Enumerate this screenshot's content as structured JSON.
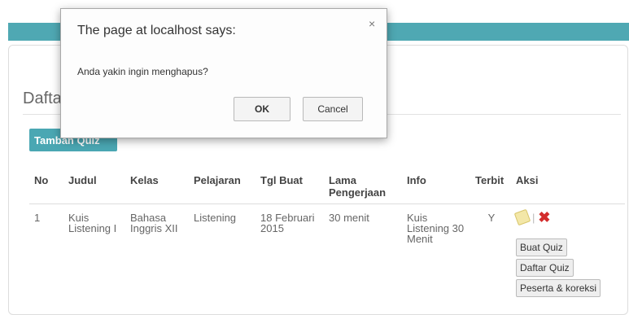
{
  "panel": {
    "title": "Daftar Quiz"
  },
  "toolbar": {
    "add_label": "Tambah Quiz"
  },
  "table": {
    "headers": [
      "No",
      "Judul",
      "Kelas",
      "Pelajaran",
      "Tgl Buat",
      "Lama Pengerjaan",
      "Info",
      "Terbit",
      "Aksi"
    ],
    "rows": [
      {
        "no": "1",
        "judul": "Kuis Listening I",
        "kelas": "Bahasa Inggris XII",
        "pelajaran": "Listening",
        "tgl_buat": "18 Februari 2015",
        "lama": "30 menit",
        "info": "Kuis Listening 30 Menit",
        "terbit": "Y",
        "actions": {
          "buat": "Buat Quiz",
          "daftar": "Daftar Quiz",
          "peserta": "Peserta & koreksi"
        }
      }
    ]
  },
  "dialog": {
    "title": "The page at localhost says:",
    "message": "Anda yakin ingin menghapus?",
    "ok_label": "OK",
    "cancel_label": "Cancel",
    "close_glyph": "×"
  },
  "icons": {
    "edit": "edit-icon",
    "delete": "delete-icon",
    "close": "close-icon"
  },
  "colors": {
    "accent": "#4aa7b3",
    "link": "#3a8fc1",
    "delete": "#d32c2c"
  }
}
